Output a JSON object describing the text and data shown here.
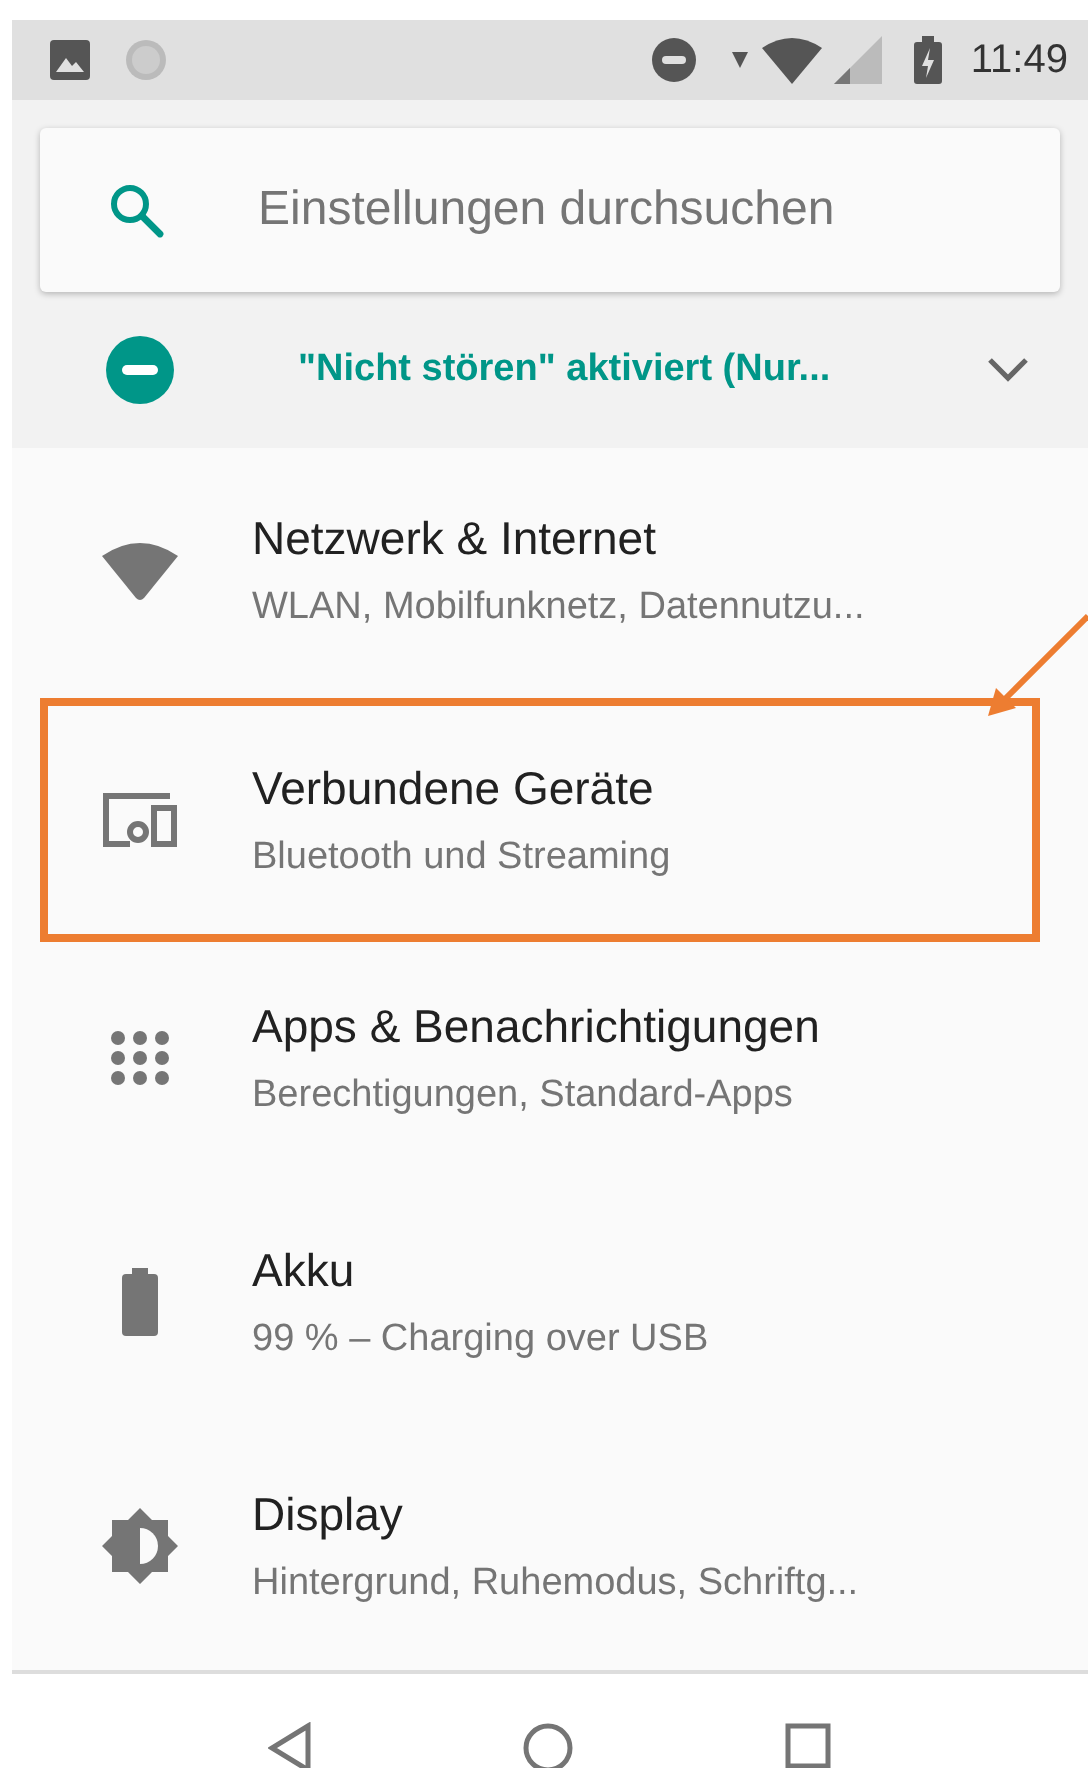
{
  "status_bar": {
    "time": "11:49"
  },
  "search": {
    "placeholder": "Einstellungen durchsuchen"
  },
  "dnd_banner": {
    "text": "\"Nicht stören\" aktiviert (Nur...",
    "expanded": false
  },
  "items": [
    {
      "kind": "wifi",
      "title": "Netzwerk & Internet",
      "subtitle": "WLAN, Mobilfunknetz, Datennutzu...",
      "highlighted": false
    },
    {
      "kind": "devices",
      "title": "Verbundene Geräte",
      "subtitle": "Bluetooth und Streaming",
      "highlighted": true
    },
    {
      "kind": "apps",
      "title": "Apps & Benachrichtigungen",
      "subtitle": "Berechtigungen, Standard-Apps",
      "highlighted": false
    },
    {
      "kind": "battery",
      "title": "Akku",
      "subtitle": "99 % – Charging over USB",
      "highlighted": false
    },
    {
      "kind": "display",
      "title": "Display",
      "subtitle": "Hintergrund, Ruhemodus, Schriftg...",
      "highlighted": false
    }
  ]
}
